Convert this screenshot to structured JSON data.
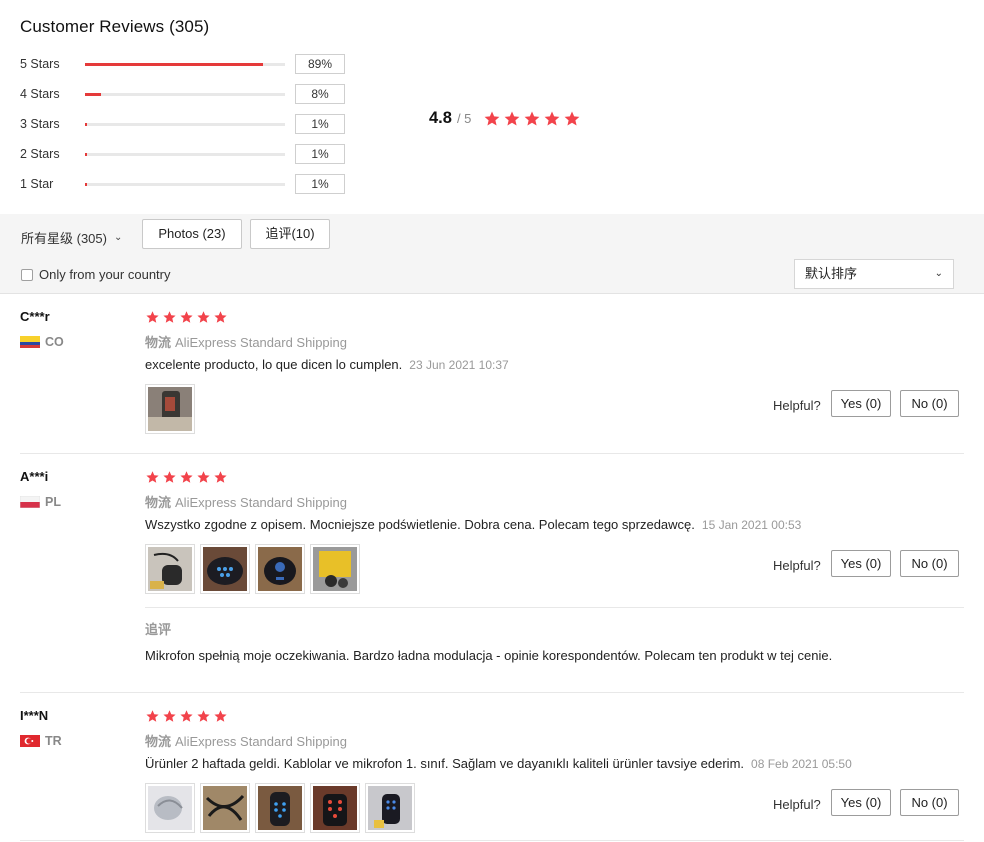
{
  "header": {
    "title": "Customer Reviews (305)"
  },
  "distribution": [
    {
      "label": "5 Stars",
      "percent_text": "89%",
      "fraction": 0.89
    },
    {
      "label": "4 Stars",
      "percent_text": "8%",
      "fraction": 0.08
    },
    {
      "label": "3 Stars",
      "percent_text": "1%",
      "fraction": 0.01
    },
    {
      "label": "2 Stars",
      "percent_text": "1%",
      "fraction": 0.01
    },
    {
      "label": "1 Star",
      "percent_text": "1%",
      "fraction": 0.01
    }
  ],
  "average": {
    "value": "4.8",
    "out_of": "/ 5",
    "stars": 5
  },
  "filters": {
    "star_filter_label": "所有星级 (305)",
    "photos_label": "Photos (23)",
    "additional_label": "追评(10)",
    "country_only_label": "Only from your country",
    "country_only_checked": false,
    "sort_label": "默认排序"
  },
  "reviews": [
    {
      "user": "C***r",
      "country": "CO",
      "stars": 5,
      "shipping_label": "物流",
      "shipping_method": "AliExpress Standard Shipping",
      "text": "excelente producto, lo que dicen lo cumplen.",
      "date": "23 Jun 2021 10:37",
      "photo_count": 1,
      "helpful_label": "Helpful?",
      "yes_label": "Yes (0)",
      "no_label": "No (0)"
    },
    {
      "user": "A***i",
      "country": "PL",
      "stars": 5,
      "shipping_label": "物流",
      "shipping_method": "AliExpress Standard Shipping",
      "text": "Wszystko zgodne z opisem. Mocniejsze podświetlenie. Dobra cena. Polecam tego sprzedawcę.",
      "date": "15 Jan 2021 00:53",
      "photo_count": 4,
      "helpful_label": "Helpful?",
      "yes_label": "Yes (0)",
      "no_label": "No (0)",
      "additional_label": "追评",
      "additional_text": "Mikrofon spełnią moje oczekiwania. Bardzo ładna modulacja - opinie korespondentów. Polecam ten produkt w tej cenie."
    },
    {
      "user": "I***N",
      "country": "TR",
      "stars": 5,
      "shipping_label": "物流",
      "shipping_method": "AliExpress Standard Shipping",
      "text": "Ürünler 2 haftada geldi. Kablolar ve mikrofon 1. sınıf. Sağlam ve dayanıklı kaliteli ürünler tavsiye ederim.",
      "date": "08 Feb 2021 05:50",
      "photo_count": 5,
      "helpful_label": "Helpful?",
      "yes_label": "Yes (0)",
      "no_label": "No (0)"
    }
  ],
  "colors": {
    "accent": "#e53a3a",
    "star": "#f2434b",
    "muted": "#999999"
  }
}
